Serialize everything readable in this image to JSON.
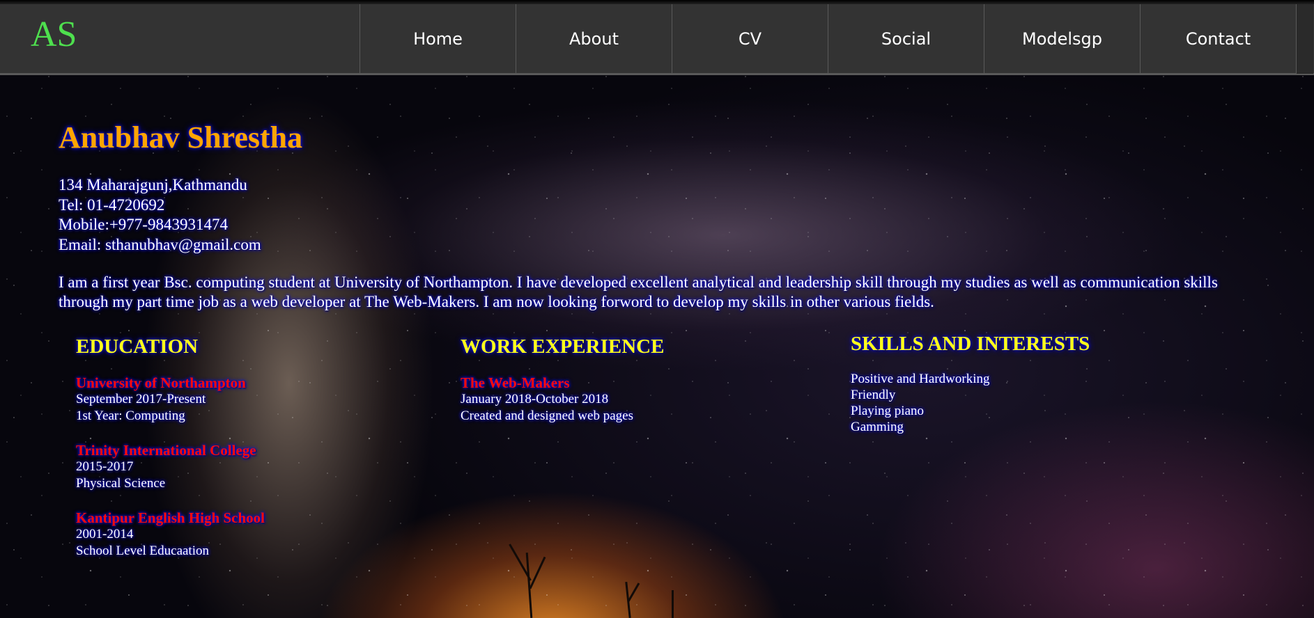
{
  "nav": {
    "logo_text": "AS",
    "items": [
      {
        "label": "Home"
      },
      {
        "label": "About"
      },
      {
        "label": "CV"
      },
      {
        "label": "Social"
      },
      {
        "label": "Modelsgp"
      },
      {
        "label": "Contact"
      }
    ]
  },
  "profile": {
    "name": "Anubhav Shrestha",
    "address": "134 Maharajgunj,Kathmandu",
    "tel": "Tel: 01-4720692",
    "mobile": "Mobile:+977-9843931474",
    "email": "Email: sthanubhav@gmail.com",
    "bio": "I am a first year Bsc. computing student at University of Northampton. I have developed excellent analytical and leadership skill through my studies as well as communication skills through my part time job as a web developer at The Web-Makers. I am now looking forword to develop my skills in other various fields."
  },
  "education": {
    "title": "EDUCATION",
    "entries": [
      {
        "name": "University of Northampton",
        "period": "September 2017-Present",
        "detail": "1st Year: Computing"
      },
      {
        "name": "Trinity International College",
        "period": "2015-2017",
        "detail": "Physical Science"
      },
      {
        "name": "Kantipur English High School",
        "period": "2001-2014",
        "detail": "School Level Educaation"
      }
    ]
  },
  "work": {
    "title": "WORK EXPERIENCE",
    "entries": [
      {
        "name": "The Web-Makers",
        "period": "January 2018-October 2018",
        "detail": "Created and designed web pages"
      }
    ]
  },
  "skills": {
    "title": "SKILLS AND INTERESTS",
    "items": [
      "Positive and Hardworking",
      "Friendly",
      "Playing piano",
      "Gamming"
    ]
  },
  "colors": {
    "nav_bg": "#333333",
    "name": "#ffa500",
    "section_title": "#ffff1a",
    "entry_title": "#ff0a0a",
    "logo": "#4ee04e"
  }
}
